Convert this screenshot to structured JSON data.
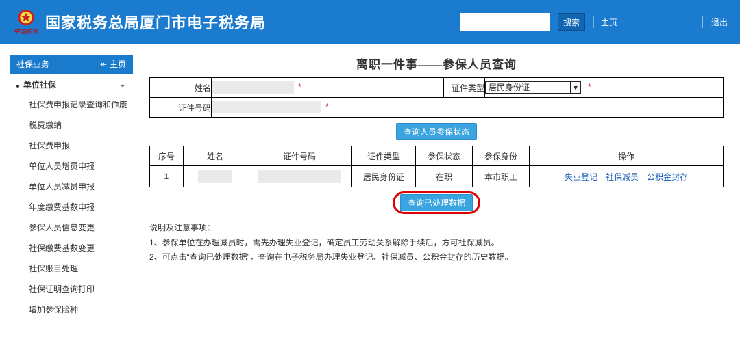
{
  "header": {
    "site_title": "国家税务总局厦门市电子税务局",
    "search_placeholder": "",
    "search_button": "搜索",
    "home_link": "主页",
    "logout_link": "退出"
  },
  "sidebar": {
    "header_title": "社保业务",
    "home_label": "主页",
    "category": "单位社保",
    "items": [
      "社保费申报记录查询和作废",
      "税费缴纳",
      "社保费申报",
      "单位人员增员申报",
      "单位人员减员申报",
      "年度缴费基数申报",
      "参保人员信息变更",
      "社保缴费基数变更",
      "社保账目处理",
      "社保证明查询打印",
      "增加参保险种"
    ]
  },
  "main": {
    "page_title": "离职一件事——参保人员查询",
    "form": {
      "name_label": "姓名",
      "id_type_label": "证件类型",
      "id_type_value": "居民身份证",
      "id_number_label": "证件号码"
    },
    "btn_query_status": "查询人员参保状态",
    "table_headers": [
      "序号",
      "姓名",
      "证件号码",
      "证件类型",
      "参保状态",
      "参保身份",
      "操作"
    ],
    "row": {
      "seq": "1",
      "name": "",
      "idno": "",
      "idtype": "居民身份证",
      "status": "在职",
      "identity": "本市职工",
      "ops": [
        "失业登记",
        "社保减员",
        "公积金封存"
      ]
    },
    "btn_query_processed": "查询已处理数据",
    "notes_title": "说明及注意事项：",
    "notes": [
      "1、参保单位在办理减员时，需先办理失业登记，确定员工劳动关系解除手续后，方可社保减员。",
      "2、可点击“查询已处理数据”，查询在电子税务局办理失业登记、社保减员、公积金封存的历史数据。"
    ]
  }
}
